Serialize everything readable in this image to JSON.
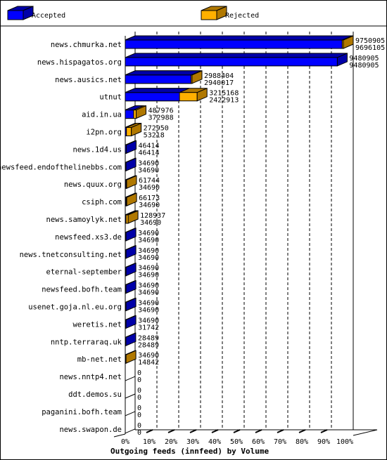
{
  "chart_data": {
    "type": "bar",
    "orientation": "horizontal",
    "stacked": true,
    "style": "3d",
    "title": "Outgoing feeds (innfeed) by Volume",
    "legend": {
      "placement": "top",
      "entries": [
        "Accepted",
        "Rejected"
      ]
    },
    "colors": {
      "Accepted": "#0000ff",
      "Rejected": "#ffb000",
      "Accepted_side": "#0000a8",
      "Rejected_side": "#b07800"
    },
    "xlim": [
      0,
      100
    ],
    "xunit": "%",
    "xticks": [
      "0%",
      "10%",
      "20%",
      "30%",
      "40%",
      "50%",
      "60%",
      "70%",
      "80%",
      "90%",
      "100%"
    ],
    "grid": true,
    "categories": [
      "news.chmurka.net",
      "news.hispagatos.org",
      "news.ausics.net",
      "utnut",
      "aid.in.ua",
      "i2pn.org",
      "news.1d4.us",
      "newsfeed.endofthelinebbs.com",
      "news.quux.org",
      "csiph.com",
      "news.samoylyk.net",
      "newsfeed.xs3.de",
      "news.tnetconsulting.net",
      "eternal-september",
      "newsfeed.bofh.team",
      "usenet.goja.nl.eu.org",
      "weretis.net",
      "nntp.terraraq.uk",
      "mb-net.net",
      "news.nntp4.net",
      "ddt.demos.su",
      "paganini.bofh.team",
      "news.swapon.de"
    ],
    "totals": [
      9750905,
      9480905,
      2988404,
      3215168,
      487976,
      272950,
      46414,
      34690,
      61744,
      66173,
      128937,
      34690,
      34690,
      34690,
      34690,
      34690,
      34690,
      28489,
      34690,
      0,
      0,
      0,
      0
    ],
    "accepted": [
      9696105,
      9480905,
      2940017,
      2422913,
      372988,
      53218,
      46414,
      34690,
      34690,
      34690,
      34690,
      34690,
      34690,
      34690,
      34690,
      34690,
      31742,
      28489,
      14842,
      0,
      0,
      0,
      0
    ]
  }
}
